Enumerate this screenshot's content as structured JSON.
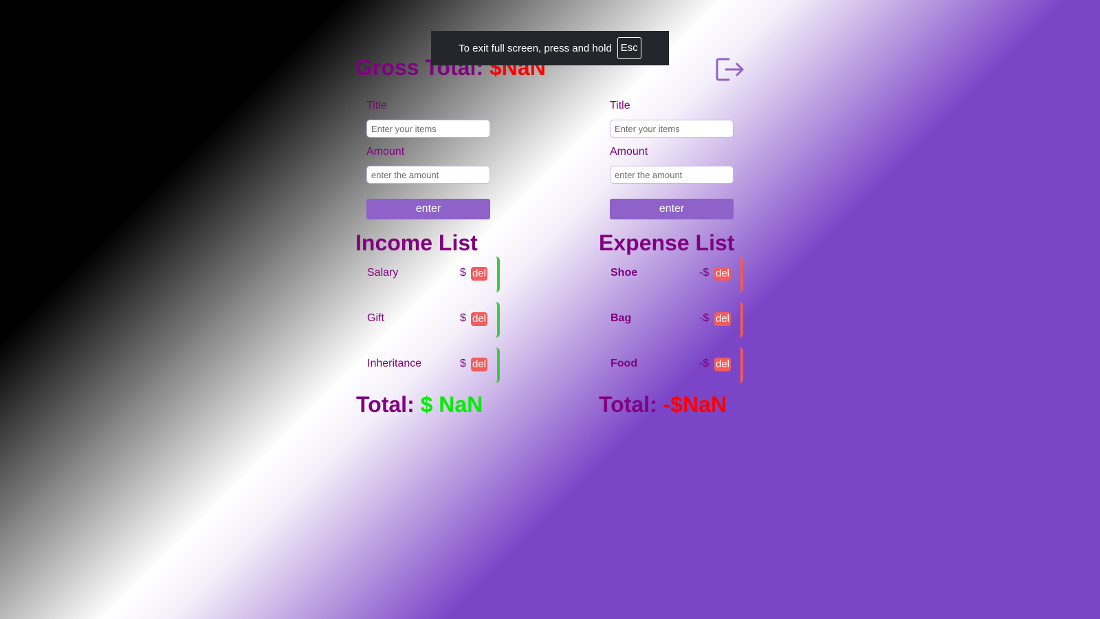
{
  "gross": {
    "label": "Gross Total:",
    "value": "$NaN"
  },
  "forms": [
    {
      "title_label": "Title",
      "title_placeholder": "Enter your items",
      "amount_label": "Amount",
      "amount_placeholder": "enter the amount",
      "button": "enter"
    },
    {
      "title_label": "Title",
      "title_placeholder": "Enter your items",
      "amount_label": "Amount",
      "amount_placeholder": "enter the amount",
      "button": "enter"
    }
  ],
  "income": {
    "title": "Income List",
    "items": [
      {
        "name": "Salary",
        "currency": "$",
        "del": "del"
      },
      {
        "name": "Gift",
        "currency": "$",
        "del": "del"
      },
      {
        "name": "Inheritance",
        "currency": "$",
        "del": "del"
      }
    ],
    "total_label": "Total:",
    "total_value": "$ NaN"
  },
  "expense": {
    "title": "Expense List",
    "items": [
      {
        "name": "Shoe",
        "currency": "-$",
        "del": "del"
      },
      {
        "name": "Bag",
        "currency": "-$",
        "del": "del"
      },
      {
        "name": "Food",
        "currency": "-$",
        "del": "del"
      }
    ],
    "total_label": "Total:",
    "total_value": "-$NaN"
  },
  "fullscreen_banner": {
    "text": "To exit full screen, press and hold",
    "key": "Esc"
  },
  "icons": {
    "logout": "logout-icon"
  },
  "colors": {
    "accent": "#8e62c9",
    "heading": "#800080",
    "negative": "#ff0000",
    "positive": "#00ee00",
    "income_bar": "#3ccb3c",
    "expense_bar": "#ef5a5a"
  }
}
